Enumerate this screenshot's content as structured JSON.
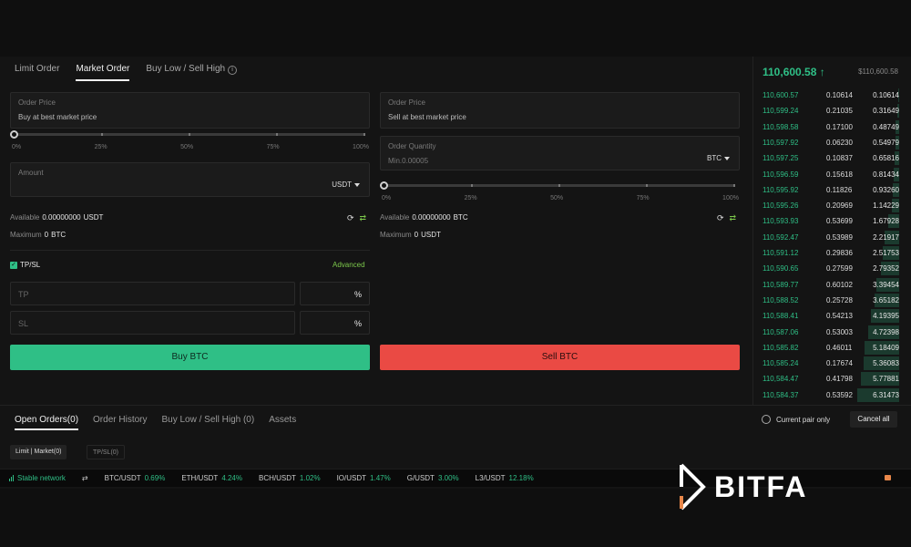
{
  "order_tabs": [
    "Limit Order",
    "Market Order",
    "Buy Low / Sell High"
  ],
  "buy": {
    "price_label": "Order Price",
    "price_value": "Buy at best market price",
    "slider_marks": [
      "0%",
      "25%",
      "50%",
      "75%",
      "100%"
    ],
    "amount_label": "Amount",
    "amount_unit": "USDT",
    "available_label": "Available",
    "available_value": "0.00000000",
    "available_unit": "USDT",
    "maximum_label": "Maximum",
    "maximum_value": "0",
    "maximum_unit": "BTC",
    "button": "Buy BTC"
  },
  "sell": {
    "price_label": "Order Price",
    "price_value": "Sell at best market price",
    "qty_label": "Order Quantity",
    "qty_placeholder": "Min.0.00005",
    "qty_unit": "BTC",
    "slider_marks": [
      "0%",
      "25%",
      "50%",
      "75%",
      "100%"
    ],
    "available_label": "Available",
    "available_value": "0.00000000",
    "available_unit": "BTC",
    "maximum_label": "Maximum",
    "maximum_value": "0",
    "maximum_unit": "USDT",
    "button": "Sell BTC"
  },
  "tpsl": {
    "label": "TP/SL",
    "advanced": "Advanced",
    "tp_placeholder": "TP",
    "sl_placeholder": "SL",
    "pct": "%"
  },
  "orderbook": {
    "last_price": "110,600.58",
    "last_usd": "$110,600.58",
    "rows": [
      {
        "price": "110,600.57",
        "amount": "0.10614",
        "total": "0.10614",
        "depth": 0.017
      },
      {
        "price": "110,599.24",
        "amount": "0.21035",
        "total": "0.31649",
        "depth": 0.05
      },
      {
        "price": "110,598.58",
        "amount": "0.17100",
        "total": "0.48749",
        "depth": 0.077
      },
      {
        "price": "110,597.92",
        "amount": "0.06230",
        "total": "0.54979",
        "depth": 0.087
      },
      {
        "price": "110,597.25",
        "amount": "0.10837",
        "total": "0.65816",
        "depth": 0.104
      },
      {
        "price": "110,596.59",
        "amount": "0.15618",
        "total": "0.81434",
        "depth": 0.129
      },
      {
        "price": "110,595.92",
        "amount": "0.11826",
        "total": "0.93260",
        "depth": 0.148
      },
      {
        "price": "110,595.26",
        "amount": "0.20969",
        "total": "1.14229",
        "depth": 0.181
      },
      {
        "price": "110,593.93",
        "amount": "0.53699",
        "total": "1.67928",
        "depth": 0.266
      },
      {
        "price": "110,592.47",
        "amount": "0.53989",
        "total": "2.21917",
        "depth": 0.352
      },
      {
        "price": "110,591.12",
        "amount": "0.29836",
        "total": "2.51753",
        "depth": 0.399
      },
      {
        "price": "110,590.65",
        "amount": "0.27599",
        "total": "2.79352",
        "depth": 0.443
      },
      {
        "price": "110,589.77",
        "amount": "0.60102",
        "total": "3.39454",
        "depth": 0.538
      },
      {
        "price": "110,588.52",
        "amount": "0.25728",
        "total": "3.65182",
        "depth": 0.579
      },
      {
        "price": "110,588.41",
        "amount": "0.54213",
        "total": "4.19395",
        "depth": 0.665
      },
      {
        "price": "110,587.06",
        "amount": "0.53003",
        "total": "4.72398",
        "depth": 0.749
      },
      {
        "price": "110,585.82",
        "amount": "0.46011",
        "total": "5.18409",
        "depth": 0.821
      },
      {
        "price": "110,585.24",
        "amount": "0.17674",
        "total": "5.36083",
        "depth": 0.849
      },
      {
        "price": "110,584.47",
        "amount": "0.41798",
        "total": "5.77881",
        "depth": 0.916
      },
      {
        "price": "110,584.37",
        "amount": "0.53592",
        "total": "6.31473",
        "depth": 1.0
      }
    ]
  },
  "bottom_tabs": [
    "Open Orders(0)",
    "Order History",
    "Buy Low / Sell High (0)",
    "Assets"
  ],
  "current_pair_only": "Current pair only",
  "cancel_all": "Cancel all",
  "filters": [
    "Limit | Market(0)",
    "TP/SL(0)"
  ],
  "ticker": {
    "network": "Stable network",
    "pairs": [
      {
        "name": "BTC/USDT",
        "change": "0.69%"
      },
      {
        "name": "ETH/USDT",
        "change": "4.24%"
      },
      {
        "name": "BCH/USDT",
        "change": "1.02%"
      },
      {
        "name": "IO/USDT",
        "change": "1.47%"
      },
      {
        "name": "G/USDT",
        "change": "3.00%"
      },
      {
        "name": "L3/USDT",
        "change": "12.18%"
      }
    ]
  },
  "brand": "BITFA",
  "colors": {
    "buy": "#2fbf86",
    "sell": "#ea4a44",
    "advanced": "#7cc84b"
  }
}
